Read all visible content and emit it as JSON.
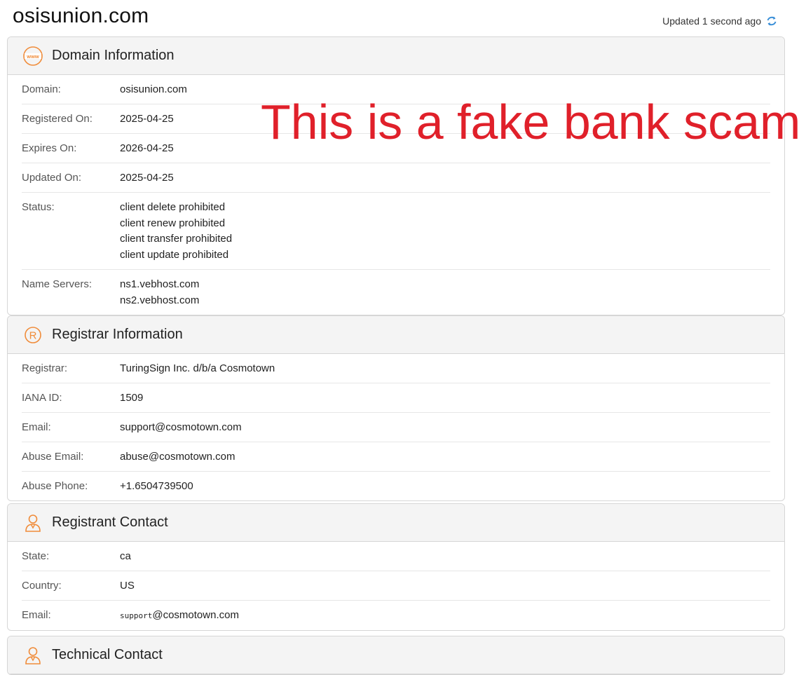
{
  "page": {
    "title": "osisunion.com",
    "updated": "Updated 1 second ago"
  },
  "overlay_text": "This is a fake bank scam",
  "domain_info": {
    "title": "Domain Information",
    "icon": "www-icon",
    "rows": {
      "domain": {
        "label": "Domain:",
        "value": "osisunion.com"
      },
      "registered": {
        "label": "Registered On:",
        "value": "2025-04-25"
      },
      "expires": {
        "label": "Expires On:",
        "value": "2026-04-25"
      },
      "updated": {
        "label": "Updated On:",
        "value": "2025-04-25"
      },
      "status": {
        "label": "Status:",
        "values": [
          "client delete prohibited",
          "client renew prohibited",
          "client transfer prohibited",
          "client update prohibited"
        ]
      },
      "nameservers": {
        "label": "Name Servers:",
        "values": [
          "ns1.vebhost.com",
          "ns2.vebhost.com"
        ]
      }
    }
  },
  "registrar_info": {
    "title": "Registrar Information",
    "icon": "registered-icon",
    "rows": {
      "registrar": {
        "label": "Registrar:",
        "value": "TuringSign Inc. d/b/a Cosmotown"
      },
      "iana": {
        "label": "IANA ID:",
        "value": "1509"
      },
      "email": {
        "label": "Email:",
        "value": "support@cosmotown.com"
      },
      "abuse_email": {
        "label": "Abuse Email:",
        "value": "abuse@cosmotown.com"
      },
      "abuse_phone": {
        "label": "Abuse Phone:",
        "value": "+1.6504739500"
      }
    }
  },
  "registrant_contact": {
    "title": "Registrant Contact",
    "icon": "person-icon",
    "rows": {
      "state": {
        "label": "State:",
        "value": "ca"
      },
      "country": {
        "label": "Country:",
        "value": "US"
      },
      "email": {
        "label": "Email:",
        "value_prefix": "support",
        "value_suffix": "@cosmotown.com"
      }
    }
  },
  "technical_contact": {
    "title": "Technical Contact",
    "icon": "person-icon"
  },
  "colors": {
    "accent_orange": "#f08c3a",
    "refresh_blue": "#3a8fd8",
    "overlay_red": "#e0202a"
  }
}
